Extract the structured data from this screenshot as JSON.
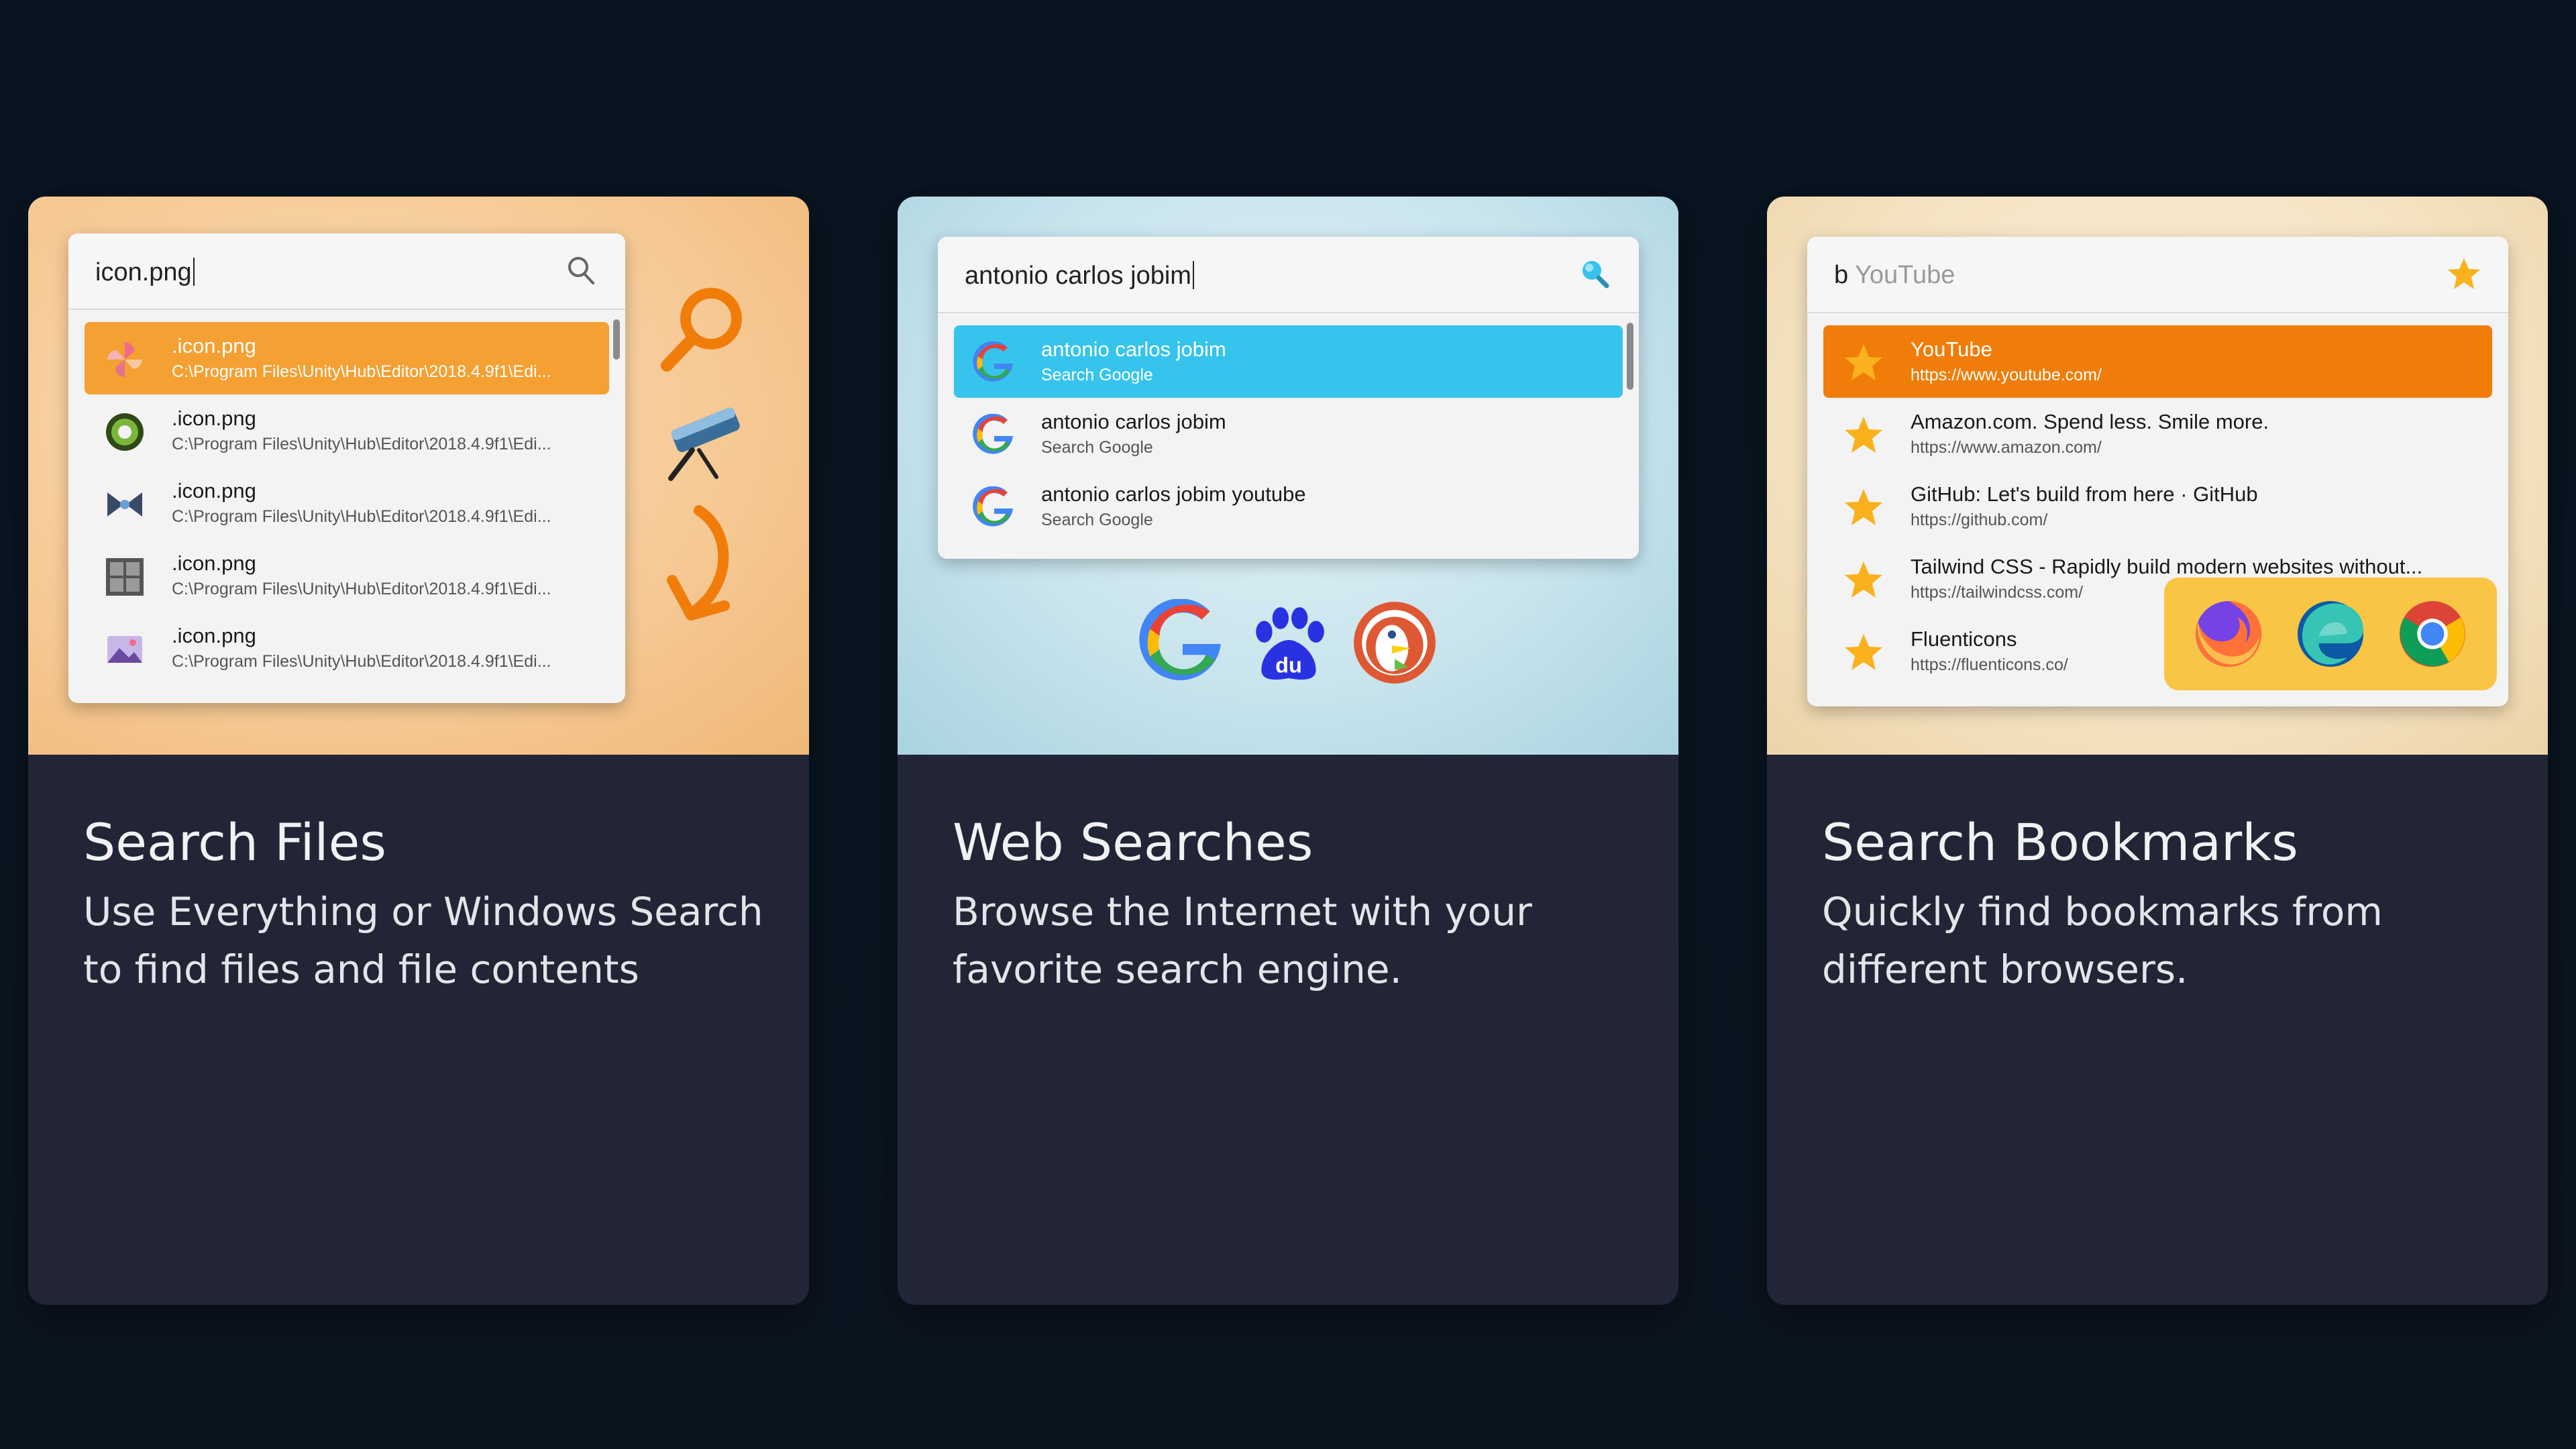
{
  "cards": [
    {
      "title": "Search Files",
      "description": "Use Everything or Windows Search to find files and file contents",
      "query": "icon.png",
      "results": [
        {
          "name": ".icon.png",
          "path": "C:\\Program Files\\Unity\\Hub\\Editor\\2018.4.9f1\\Edi...",
          "icon": "pinwheel-icon"
        },
        {
          "name": ".icon.png",
          "path": "C:\\Program Files\\Unity\\Hub\\Editor\\2018.4.9f1\\Edi...",
          "icon": "green-ring-icon"
        },
        {
          "name": ".icon.png",
          "path": "C:\\Program Files\\Unity\\Hub\\Editor\\2018.4.9f1\\Edi...",
          "icon": "bowtie-icon"
        },
        {
          "name": ".icon.png",
          "path": "C:\\Program Files\\Unity\\Hub\\Editor\\2018.4.9f1\\Edi...",
          "icon": "grid-icon"
        },
        {
          "name": ".icon.png",
          "path": "C:\\Program Files\\Unity\\Hub\\Editor\\2018.4.9f1\\Edi...",
          "icon": "landscape-icon"
        }
      ],
      "side_icons": [
        "magnifier-icon",
        "telescope-icon",
        "curved-arrow-icon"
      ]
    },
    {
      "title": "Web Searches",
      "description": "Browse the Internet with your favorite search engine.",
      "query": "antonio carlos jobim",
      "results": [
        {
          "name": "antonio carlos jobim",
          "sub": "Search Google"
        },
        {
          "name": "antonio carlos jobim",
          "sub": "Search Google"
        },
        {
          "name": "antonio carlos jobim youtube",
          "sub": "Search Google"
        }
      ],
      "engines": [
        "google-logo-icon",
        "baidu-logo-icon",
        "duckduckgo-logo-icon"
      ]
    },
    {
      "title": "Search Bookmarks",
      "description": "Quickly find bookmarks from different browsers.",
      "query_prefix": "b",
      "query_ghost": "YouTube",
      "results": [
        {
          "name": "YouTube",
          "url": "https://www.youtube.com/"
        },
        {
          "name": "Amazon.com. Spend less. Smile more.",
          "url": "https://www.amazon.com/"
        },
        {
          "name": "GitHub: Let's build from here · GitHub",
          "url": "https://github.com/"
        },
        {
          "name": "Tailwind CSS - Rapidly build modern websites without...",
          "url": "https://tailwindcss.com/"
        },
        {
          "name": "Fluenticons",
          "url": "https://fluenticons.co/"
        }
      ],
      "browsers": [
        "firefox-icon",
        "edge-icon",
        "chrome-icon"
      ]
    }
  ],
  "colors": {
    "files_accent": "#f4a032",
    "web_accent": "#36c4ec",
    "bookmarks_accent": "#f07d0a",
    "star": "#f9b21d"
  }
}
